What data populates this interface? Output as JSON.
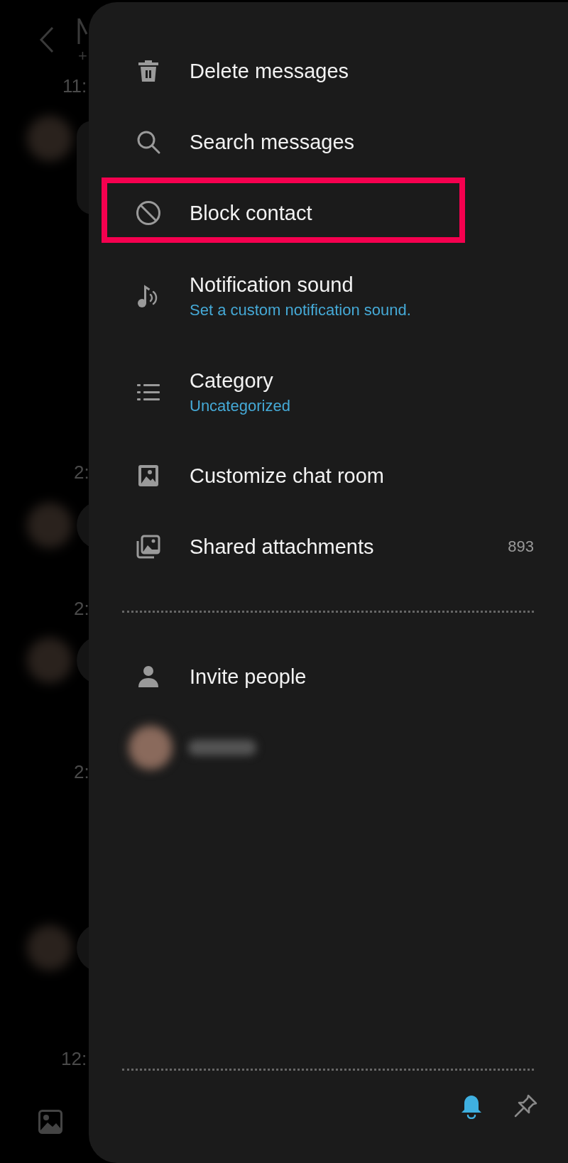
{
  "chat_background": {
    "subtitle": "+",
    "timestamps": [
      "11:",
      "2:",
      "2:",
      "2:",
      "12:"
    ]
  },
  "menu": {
    "items": [
      {
        "title": "Delete messages",
        "highlighted": false
      },
      {
        "title": "Search messages",
        "highlighted": false
      },
      {
        "title": "Block contact",
        "highlighted": true
      },
      {
        "title": "Notification sound",
        "subtitle": "Set a custom notification sound.",
        "highlighted": false
      },
      {
        "title": "Category",
        "subtitle": "Uncategorized",
        "highlighted": false
      },
      {
        "title": "Customize chat room",
        "highlighted": false
      },
      {
        "title": "Shared attachments",
        "count": "893",
        "highlighted": false
      }
    ],
    "invite": {
      "title": "Invite people"
    },
    "footer": [
      {
        "kind": "notifications",
        "on": true
      },
      {
        "kind": "pin",
        "on": false
      }
    ]
  }
}
